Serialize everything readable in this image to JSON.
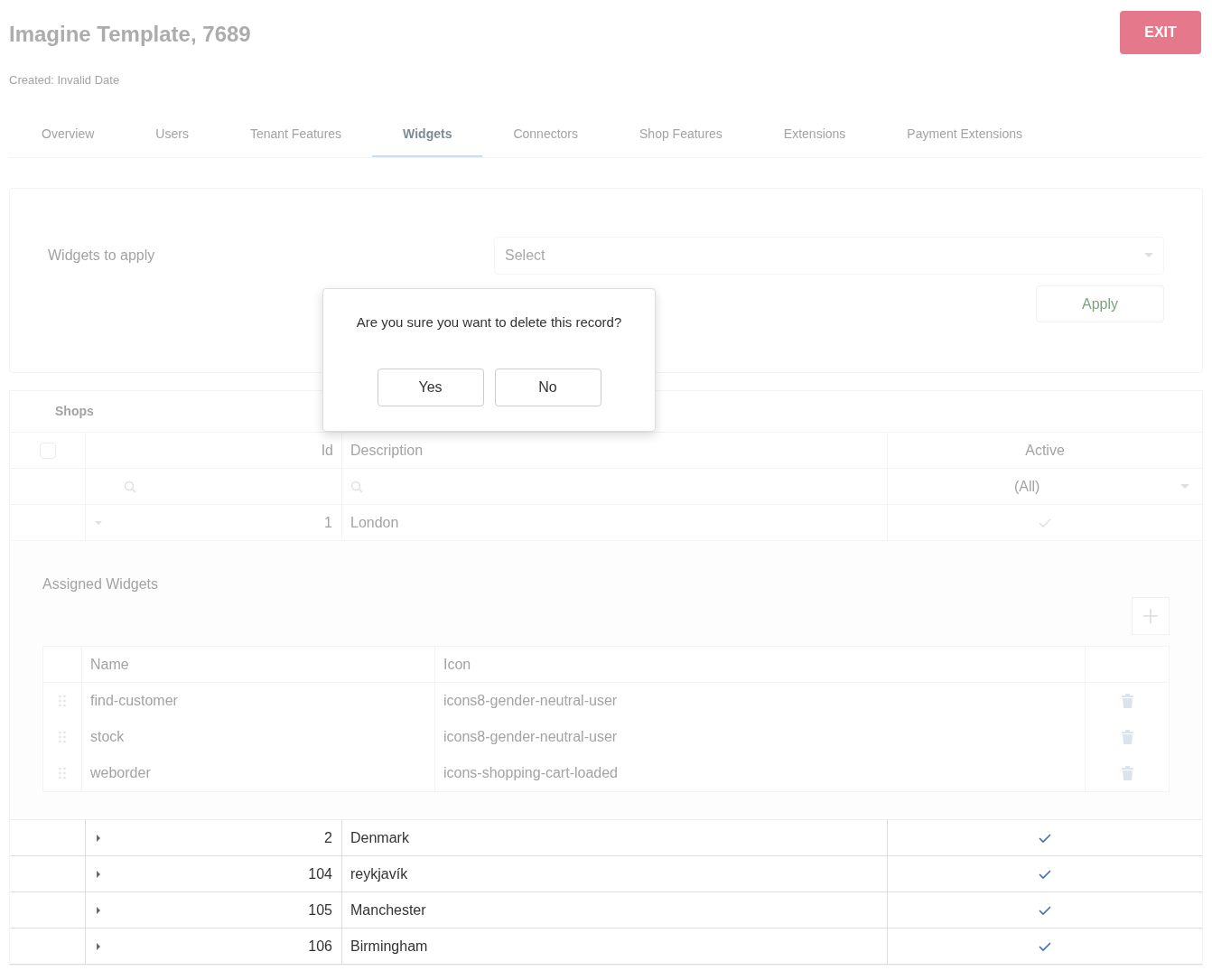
{
  "header": {
    "title": "Imagine Template, 7689",
    "created": "Created: Invalid Date",
    "exit_button": "EXIT"
  },
  "tabs": [
    {
      "label": "Overview",
      "selected": false
    },
    {
      "label": "Users",
      "selected": false
    },
    {
      "label": "Tenant Features",
      "selected": false
    },
    {
      "label": "Widgets",
      "selected": true
    },
    {
      "label": "Connectors",
      "selected": false
    },
    {
      "label": "Shop Features",
      "selected": false
    },
    {
      "label": "Extensions",
      "selected": false
    },
    {
      "label": "Payment Extensions",
      "selected": false
    }
  ],
  "widgets_panel": {
    "label": "Widgets to apply",
    "select": {
      "placeholder": "Select"
    },
    "apply_button": "Apply"
  },
  "shops": {
    "title": "Shops",
    "select_all": {
      "checked": false
    },
    "columns": [
      "Id",
      "Description",
      "Active"
    ],
    "active_filter": "(All)",
    "rows": [
      {
        "id": "1",
        "description": "London",
        "active": true,
        "expanded": true
      },
      {
        "id": "2",
        "description": "Denmark",
        "active": true,
        "expanded": false
      },
      {
        "id": "104",
        "description": "reykjavík",
        "active": true,
        "expanded": false
      },
      {
        "id": "105",
        "description": "Manchester",
        "active": true,
        "expanded": false
      },
      {
        "id": "106",
        "description": "Birmingham",
        "active": true,
        "expanded": false
      }
    ],
    "detail": {
      "title": "Assigned Widgets",
      "columns": [
        "Name",
        "Icon"
      ],
      "rows": [
        {
          "name": "find-customer",
          "icon": "icons8-gender-neutral-user"
        },
        {
          "name": "stock",
          "icon": "icons8-gender-neutral-user"
        },
        {
          "name": "weborder",
          "icon": "icons-shopping-cart-loaded"
        }
      ]
    }
  },
  "dialog": {
    "message": "Are you sure you want to delete this record?",
    "buttons": [
      "Yes",
      "No"
    ]
  }
}
